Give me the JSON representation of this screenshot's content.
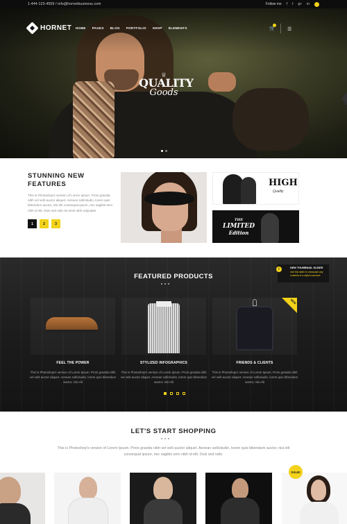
{
  "topbar": {
    "contact": "1-444-123-4559 / info@hornetbusiness.com",
    "follow_label": "Follow me",
    "social": [
      "f",
      "t",
      "g+",
      "in"
    ]
  },
  "header": {
    "logo": "HORNET",
    "nav": [
      "HOME",
      "PAGES",
      "BLOG",
      "PORTFOLIO",
      "SHOP",
      "ELEMENTS"
    ],
    "icons": {
      "cart": "cart-icon",
      "menu": "hamburger-icon"
    }
  },
  "hero": {
    "title_line1": "QUALITY",
    "title_line2": "Goods",
    "slide_count": 2,
    "active_slide": 1
  },
  "features": {
    "title": "STUNNING NEW FEATURES",
    "text": "This is Photoshop's version of Lorem Ipsum. Proin gravida nibh vel velit auctor aliquet. Aenean sollicitudin, lorem quis bibendum auctor, nisi elit consequat ipsum, nec sagittis sem nibh id elit. Duis sed odio sit amet nibh vulputate",
    "buttons": [
      "1",
      "2",
      "3"
    ],
    "promo_high": "HIGH",
    "promo_quality": "Quality",
    "promo_limited_1": "THE",
    "promo_limited_2": "LIMITED",
    "promo_limited_3": "Edition"
  },
  "products": {
    "title": "FEATURED PRODUCTS",
    "items": [
      {
        "title": "FEEL THE POWER",
        "text": "This is Photoshop's version of Lorem Ipsum. Proin gravida nibh vel velit auctor aliquet. Aenean sollicitudin, lorem quis bibendum auctor, nisi elit"
      },
      {
        "title": "STYLIZED INFOGRAPHICS",
        "text": "This is Photoshop's version of Lorem Ipsum. Proin gravida nibh vel velit auctor aliquet. Aenean sollicitudin, lorem quis bibendum auctor, nisi elit"
      },
      {
        "title": "FRIENDS & CLIENTS",
        "text": "This is Photoshop's version of Lorem Ipsum. Proin gravida nibh vel velit auctor aliquet. Aenean sollicitudin, lorem quis bibendum auctor, nisi elit"
      }
    ],
    "new_badge": "NEW",
    "pager_count": 4,
    "pager_active": 0,
    "tooltip_title": "NEW THUMBNAIL SLIDER",
    "tooltip_text": "Use this slider to showcase any contents in a stylish carousel"
  },
  "shopping": {
    "title": "LET'S START SHOPPING",
    "text": "This is Photoshop's version of Lorem Ipsum. Proin gravida nibh vel velit auctor aliquet. Aenean sollicitudin, lorem quis bibendum auctor, nisi elit consequat ipsum, nec sagittis sem nibh id elit. Duis sed odio.",
    "sale_badge": "SALE!"
  },
  "colors": {
    "accent": "#f2d21b",
    "dark": "#111111"
  }
}
